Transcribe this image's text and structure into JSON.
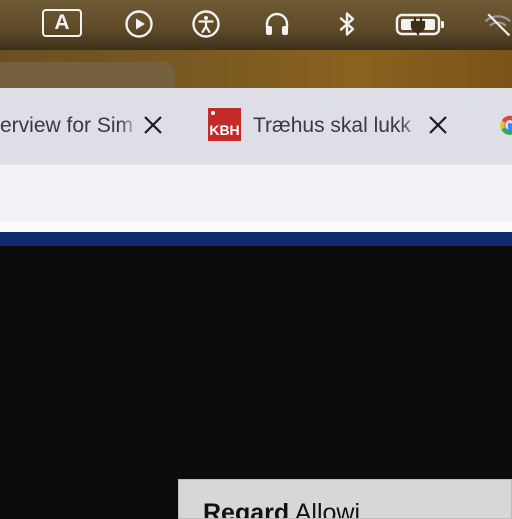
{
  "menubar": {
    "input_source_label": "A",
    "icons": [
      "input-source-icon",
      "play-icon",
      "accessibility-icon",
      "headphones-icon",
      "bluetooth-icon",
      "battery-charging-icon",
      "wifi-icon"
    ]
  },
  "tabs": [
    {
      "title": "erview for Sim",
      "favicon": ""
    },
    {
      "title": "Træhus skal lukk",
      "favicon": "KBH"
    },
    {
      "title": "",
      "favicon": "google-icon"
    }
  ],
  "page": {
    "card_bold": "Regard",
    "card_text": "Allowi"
  },
  "colors": {
    "navy_bar": "#0f2b6e",
    "kbh_red": "#c42a2a"
  }
}
